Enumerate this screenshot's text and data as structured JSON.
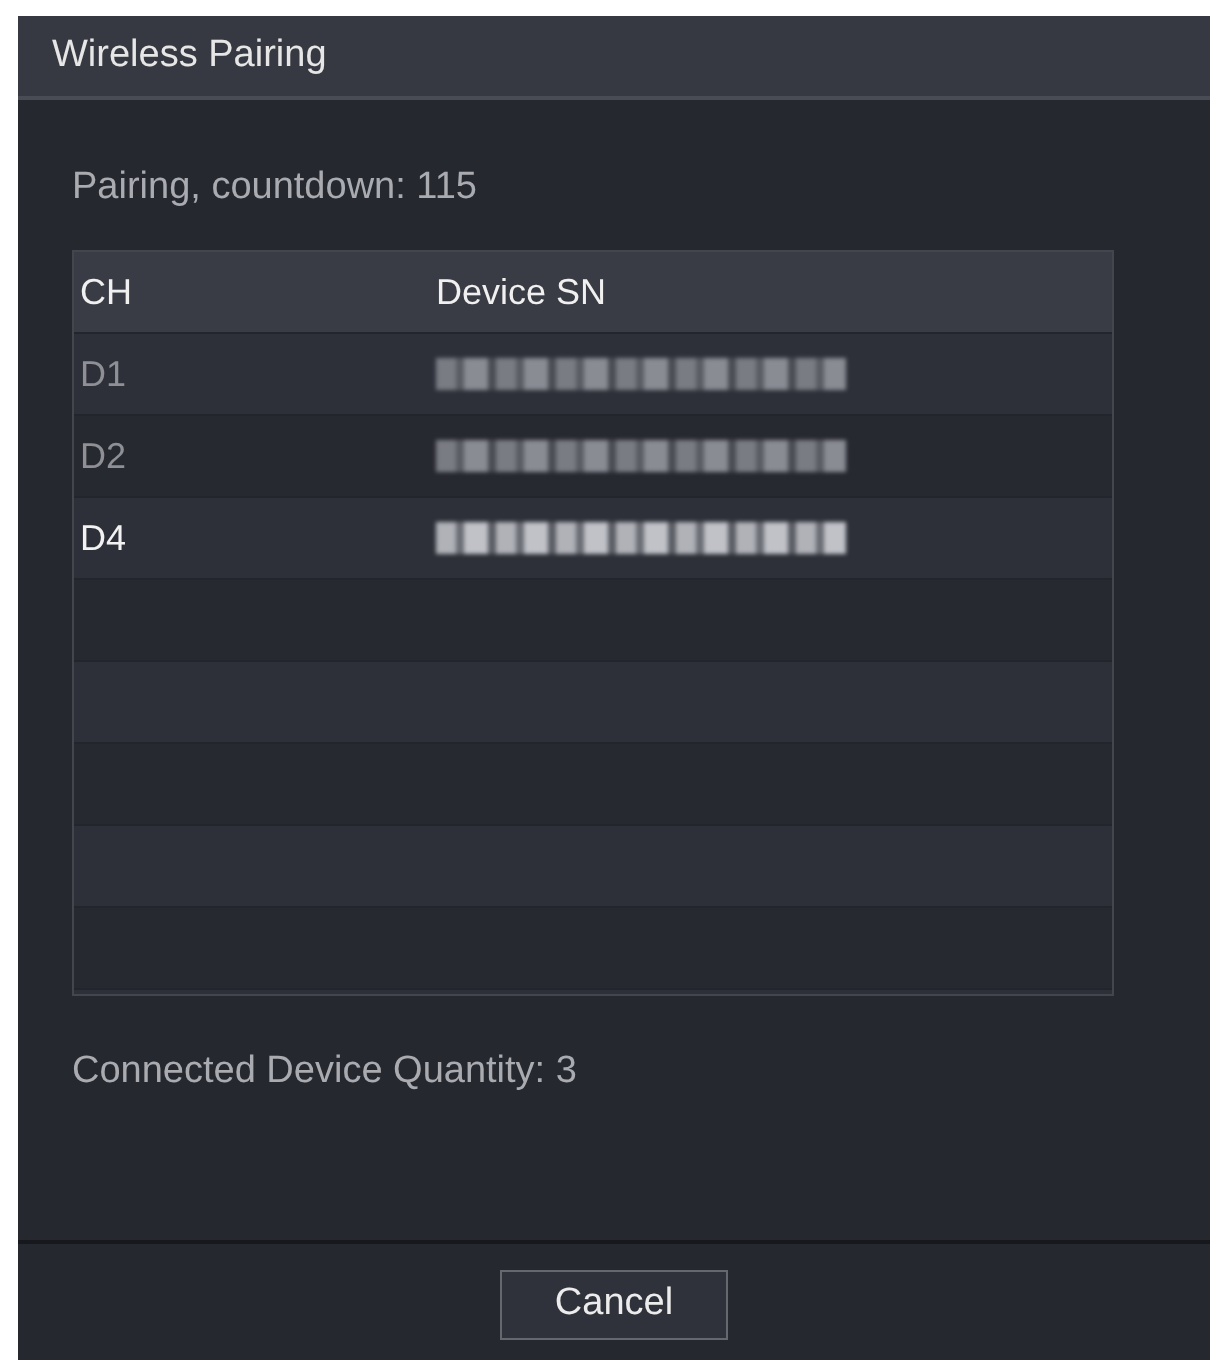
{
  "window": {
    "title": "Wireless Pairing"
  },
  "status": "Pairing, countdown: 115",
  "table": {
    "columns": [
      "CH",
      "Device SN"
    ],
    "rows": [
      {
        "ch": "D1",
        "disabled": true
      },
      {
        "ch": "D2",
        "disabled": true
      },
      {
        "ch": "D4",
        "disabled": false
      }
    ]
  },
  "summary": "Connected Device Quantity: 3",
  "buttons": [
    "Cancel"
  ]
}
